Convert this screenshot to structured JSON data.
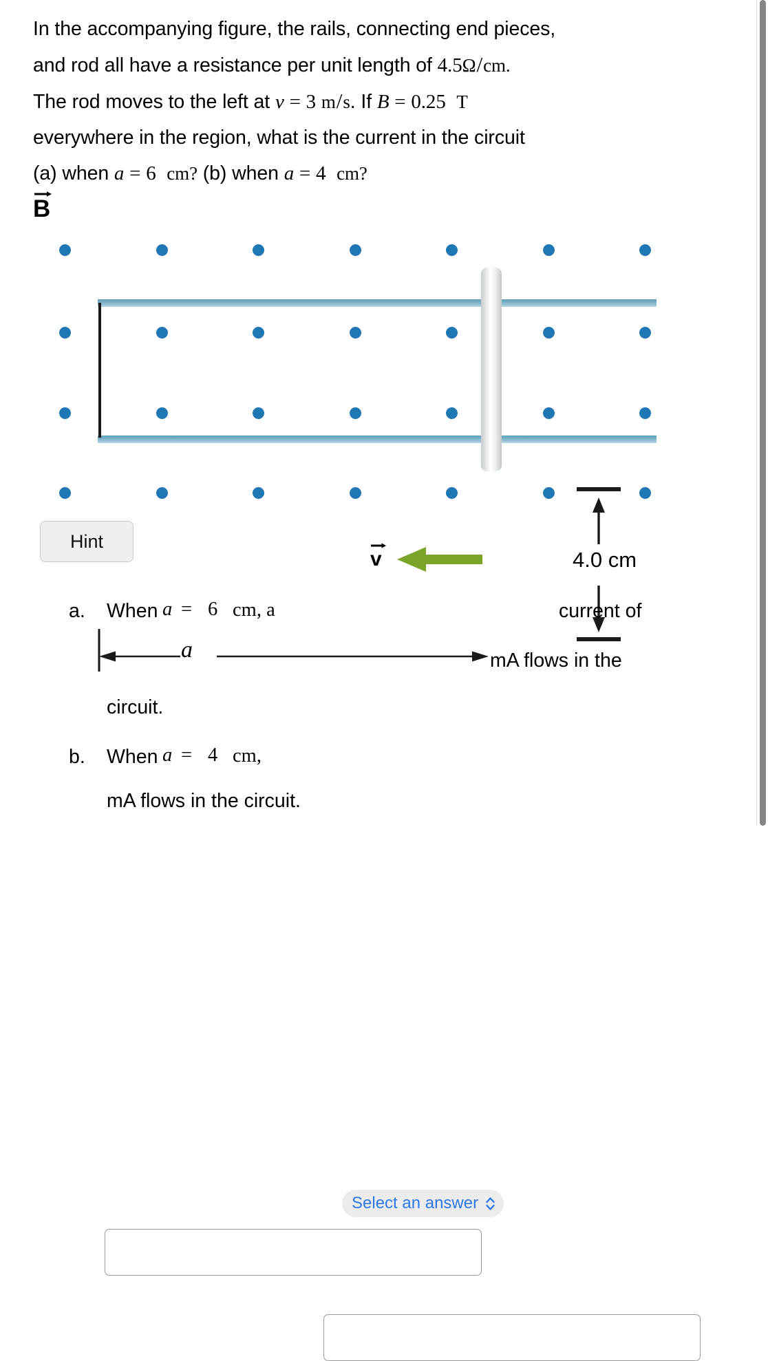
{
  "problem": {
    "line1_a": "In the accompanying figure, the rails, connecting end pieces,",
    "line2_a": "and rod all have a resistance per unit length of ",
    "resistance_value": "4.5",
    "resistance_unit_num": "Ω",
    "resistance_unit_den": "cm",
    "line3_a": "The rod moves to the left at ",
    "v_symbol": "v",
    "eq": "=",
    "v_value": "3",
    "v_unit_num": "m",
    "v_unit_den": "s",
    "line3_b": ". If ",
    "B_symbol": "B",
    "B_value": "0.25",
    "B_unit": "T",
    "line4_a": "everywhere in the region, what is the current in the circuit",
    "line5_a": "(a) when ",
    "a_symbol": "a",
    "a_value_1": "6",
    "unit_cm": "cm?",
    "line5_b": " (b) when ",
    "a_value_2": "4"
  },
  "figure": {
    "b_field_label": "B",
    "velocity_label": "v",
    "distance_label": "a",
    "height_label": "4.0 cm",
    "dot_color": "#1f77b4",
    "rail_color": "#76aec6",
    "rod_color": "#d6dadb",
    "velocity_arrow_color": "#7ba428",
    "dot_rows": 4,
    "dot_cols": 7
  },
  "hint": {
    "label": "Hint"
  },
  "answers": {
    "part_a": {
      "marker": "a.",
      "text_before_var": "When ",
      "var": "a",
      "eq": "=",
      "value": "6",
      "unit": "cm, a",
      "dropdown_label": "Select an answer",
      "dropdown_icon": "chevron-updown-icon",
      "text_after_dropdown": "current of",
      "input_value": "",
      "input_placeholder": "",
      "text_after_input": "mA flows in the",
      "text_last_line": "circuit."
    },
    "part_b": {
      "marker": "b.",
      "text_before_var": "When ",
      "var": "a",
      "eq": "=",
      "value": "4",
      "unit": "cm,",
      "input_value": "",
      "input_placeholder": "",
      "text_after_input": "mA flows in the circuit."
    }
  },
  "scrollbar": {
    "thumb_color": "#868686"
  }
}
